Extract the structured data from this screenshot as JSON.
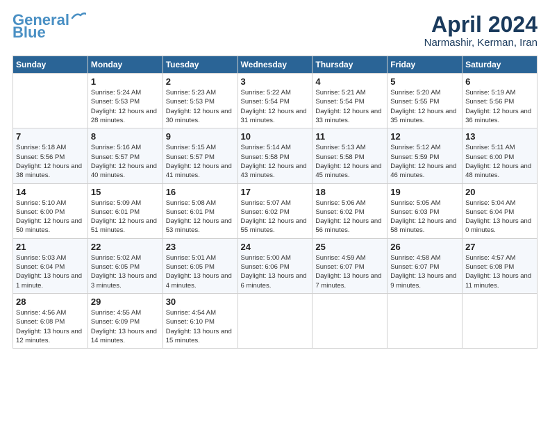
{
  "header": {
    "logo_line1": "General",
    "logo_line2": "Blue",
    "title": "April 2024",
    "location": "Narmashir, Kerman, Iran"
  },
  "days_of_week": [
    "Sunday",
    "Monday",
    "Tuesday",
    "Wednesday",
    "Thursday",
    "Friday",
    "Saturday"
  ],
  "weeks": [
    [
      {
        "day": "",
        "sunrise": "",
        "sunset": "",
        "daylight": ""
      },
      {
        "day": "1",
        "sunrise": "Sunrise: 5:24 AM",
        "sunset": "Sunset: 5:53 PM",
        "daylight": "Daylight: 12 hours and 28 minutes."
      },
      {
        "day": "2",
        "sunrise": "Sunrise: 5:23 AM",
        "sunset": "Sunset: 5:53 PM",
        "daylight": "Daylight: 12 hours and 30 minutes."
      },
      {
        "day": "3",
        "sunrise": "Sunrise: 5:22 AM",
        "sunset": "Sunset: 5:54 PM",
        "daylight": "Daylight: 12 hours and 31 minutes."
      },
      {
        "day": "4",
        "sunrise": "Sunrise: 5:21 AM",
        "sunset": "Sunset: 5:54 PM",
        "daylight": "Daylight: 12 hours and 33 minutes."
      },
      {
        "day": "5",
        "sunrise": "Sunrise: 5:20 AM",
        "sunset": "Sunset: 5:55 PM",
        "daylight": "Daylight: 12 hours and 35 minutes."
      },
      {
        "day": "6",
        "sunrise": "Sunrise: 5:19 AM",
        "sunset": "Sunset: 5:56 PM",
        "daylight": "Daylight: 12 hours and 36 minutes."
      }
    ],
    [
      {
        "day": "7",
        "sunrise": "Sunrise: 5:18 AM",
        "sunset": "Sunset: 5:56 PM",
        "daylight": "Daylight: 12 hours and 38 minutes."
      },
      {
        "day": "8",
        "sunrise": "Sunrise: 5:16 AM",
        "sunset": "Sunset: 5:57 PM",
        "daylight": "Daylight: 12 hours and 40 minutes."
      },
      {
        "day": "9",
        "sunrise": "Sunrise: 5:15 AM",
        "sunset": "Sunset: 5:57 PM",
        "daylight": "Daylight: 12 hours and 41 minutes."
      },
      {
        "day": "10",
        "sunrise": "Sunrise: 5:14 AM",
        "sunset": "Sunset: 5:58 PM",
        "daylight": "Daylight: 12 hours and 43 minutes."
      },
      {
        "day": "11",
        "sunrise": "Sunrise: 5:13 AM",
        "sunset": "Sunset: 5:58 PM",
        "daylight": "Daylight: 12 hours and 45 minutes."
      },
      {
        "day": "12",
        "sunrise": "Sunrise: 5:12 AM",
        "sunset": "Sunset: 5:59 PM",
        "daylight": "Daylight: 12 hours and 46 minutes."
      },
      {
        "day": "13",
        "sunrise": "Sunrise: 5:11 AM",
        "sunset": "Sunset: 6:00 PM",
        "daylight": "Daylight: 12 hours and 48 minutes."
      }
    ],
    [
      {
        "day": "14",
        "sunrise": "Sunrise: 5:10 AM",
        "sunset": "Sunset: 6:00 PM",
        "daylight": "Daylight: 12 hours and 50 minutes."
      },
      {
        "day": "15",
        "sunrise": "Sunrise: 5:09 AM",
        "sunset": "Sunset: 6:01 PM",
        "daylight": "Daylight: 12 hours and 51 minutes."
      },
      {
        "day": "16",
        "sunrise": "Sunrise: 5:08 AM",
        "sunset": "Sunset: 6:01 PM",
        "daylight": "Daylight: 12 hours and 53 minutes."
      },
      {
        "day": "17",
        "sunrise": "Sunrise: 5:07 AM",
        "sunset": "Sunset: 6:02 PM",
        "daylight": "Daylight: 12 hours and 55 minutes."
      },
      {
        "day": "18",
        "sunrise": "Sunrise: 5:06 AM",
        "sunset": "Sunset: 6:02 PM",
        "daylight": "Daylight: 12 hours and 56 minutes."
      },
      {
        "day": "19",
        "sunrise": "Sunrise: 5:05 AM",
        "sunset": "Sunset: 6:03 PM",
        "daylight": "Daylight: 12 hours and 58 minutes."
      },
      {
        "day": "20",
        "sunrise": "Sunrise: 5:04 AM",
        "sunset": "Sunset: 6:04 PM",
        "daylight": "Daylight: 13 hours and 0 minutes."
      }
    ],
    [
      {
        "day": "21",
        "sunrise": "Sunrise: 5:03 AM",
        "sunset": "Sunset: 6:04 PM",
        "daylight": "Daylight: 13 hours and 1 minute."
      },
      {
        "day": "22",
        "sunrise": "Sunrise: 5:02 AM",
        "sunset": "Sunset: 6:05 PM",
        "daylight": "Daylight: 13 hours and 3 minutes."
      },
      {
        "day": "23",
        "sunrise": "Sunrise: 5:01 AM",
        "sunset": "Sunset: 6:05 PM",
        "daylight": "Daylight: 13 hours and 4 minutes."
      },
      {
        "day": "24",
        "sunrise": "Sunrise: 5:00 AM",
        "sunset": "Sunset: 6:06 PM",
        "daylight": "Daylight: 13 hours and 6 minutes."
      },
      {
        "day": "25",
        "sunrise": "Sunrise: 4:59 AM",
        "sunset": "Sunset: 6:07 PM",
        "daylight": "Daylight: 13 hours and 7 minutes."
      },
      {
        "day": "26",
        "sunrise": "Sunrise: 4:58 AM",
        "sunset": "Sunset: 6:07 PM",
        "daylight": "Daylight: 13 hours and 9 minutes."
      },
      {
        "day": "27",
        "sunrise": "Sunrise: 4:57 AM",
        "sunset": "Sunset: 6:08 PM",
        "daylight": "Daylight: 13 hours and 11 minutes."
      }
    ],
    [
      {
        "day": "28",
        "sunrise": "Sunrise: 4:56 AM",
        "sunset": "Sunset: 6:08 PM",
        "daylight": "Daylight: 13 hours and 12 minutes."
      },
      {
        "day": "29",
        "sunrise": "Sunrise: 4:55 AM",
        "sunset": "Sunset: 6:09 PM",
        "daylight": "Daylight: 13 hours and 14 minutes."
      },
      {
        "day": "30",
        "sunrise": "Sunrise: 4:54 AM",
        "sunset": "Sunset: 6:10 PM",
        "daylight": "Daylight: 13 hours and 15 minutes."
      },
      {
        "day": "",
        "sunrise": "",
        "sunset": "",
        "daylight": ""
      },
      {
        "day": "",
        "sunrise": "",
        "sunset": "",
        "daylight": ""
      },
      {
        "day": "",
        "sunrise": "",
        "sunset": "",
        "daylight": ""
      },
      {
        "day": "",
        "sunrise": "",
        "sunset": "",
        "daylight": ""
      }
    ]
  ]
}
